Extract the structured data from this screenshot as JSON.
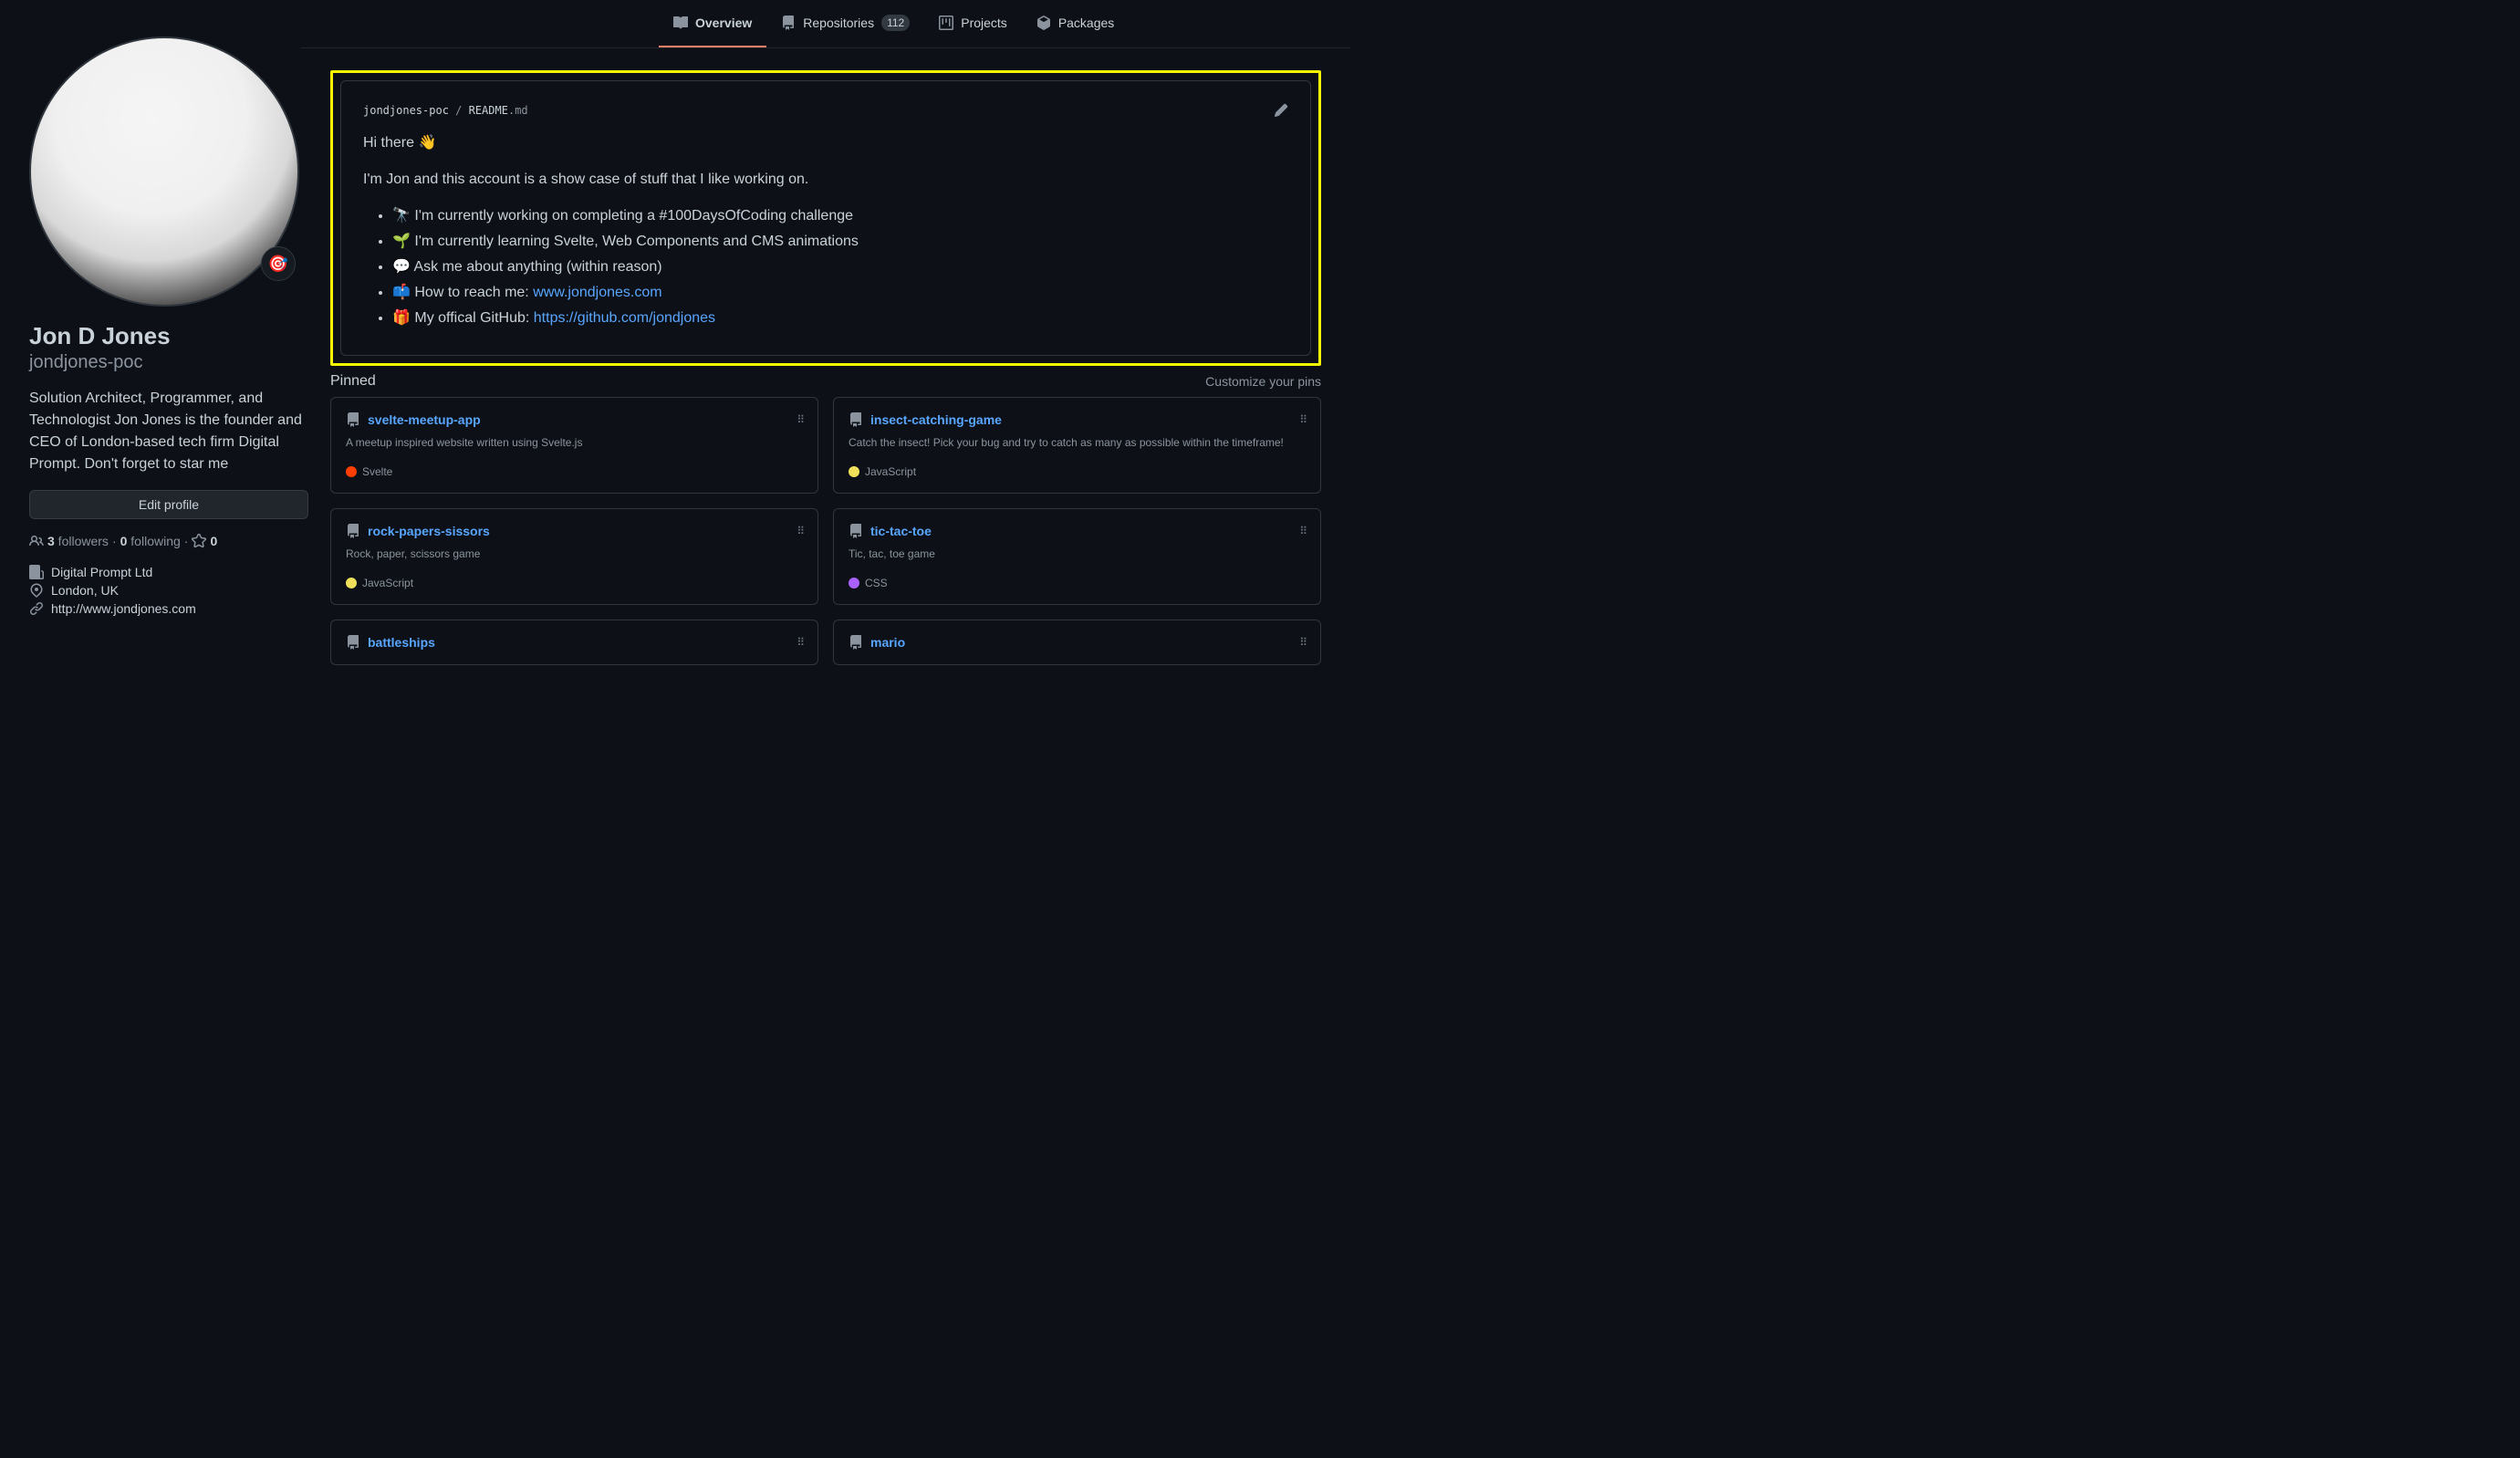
{
  "profile": {
    "name": "Jon D Jones",
    "username": "jondjones-poc",
    "bio": "Solution Architect, Programmer, and Technologist Jon Jones is the founder and CEO of London-based tech firm Digital Prompt. Don't forget to star me",
    "edit_button": "Edit profile",
    "followers_count": "3",
    "followers_label": " followers",
    "dot1": " · ",
    "following_count": "0",
    "following_label": " following",
    "dot2": " · ",
    "stars_count": "0",
    "company": "Digital Prompt Ltd",
    "location": "London, UK",
    "website": "http://www.jondjones.com",
    "status_emoji": "🎯"
  },
  "tabs": {
    "overview": "Overview",
    "repositories": "Repositories",
    "repositories_count": "112",
    "projects": "Projects",
    "packages": "Packages"
  },
  "readme": {
    "user": "jondjones-poc",
    "sep": " / ",
    "file_base": "README",
    "file_ext": ".md",
    "greeting": "Hi there 👋",
    "intro": "I'm Jon and this account is a show case of stuff that I like working on.",
    "items": {
      "working": "🔭  I'm currently working on completing a #100DaysOfCoding challenge",
      "learning": "🌱  I'm currently learning Svelte, Web Components and CMS animations",
      "ask": "💬  Ask me about anything (within reason)",
      "reach_pre": "📫  How to reach me: ",
      "reach_link": "www.jondjones.com",
      "github_pre": "🎁  My offical GitHub: ",
      "github_link": "https://github.com/jondjones"
    }
  },
  "pinned": {
    "heading": "Pinned",
    "customize": "Customize your pins",
    "cards": [
      {
        "name": "svelte-meetup-app",
        "desc": "A meetup inspired website written using Svelte.js",
        "lang": "Svelte",
        "color": "#ff3e00"
      },
      {
        "name": "insect-catching-game",
        "desc": "Catch the insect! Pick your bug and try to catch as many as possible within the timeframe!",
        "lang": "JavaScript",
        "color": "#f1e05a"
      },
      {
        "name": "rock-papers-sissors",
        "desc": "Rock, paper, scissors game",
        "lang": "JavaScript",
        "color": "#f1e05a"
      },
      {
        "name": "tic-tac-toe",
        "desc": "Tic, tac, toe game",
        "lang": "CSS",
        "color": "#a960ff"
      },
      {
        "name": "battleships",
        "desc": "",
        "lang": "",
        "color": ""
      },
      {
        "name": "mario",
        "desc": "",
        "lang": "",
        "color": ""
      }
    ]
  }
}
